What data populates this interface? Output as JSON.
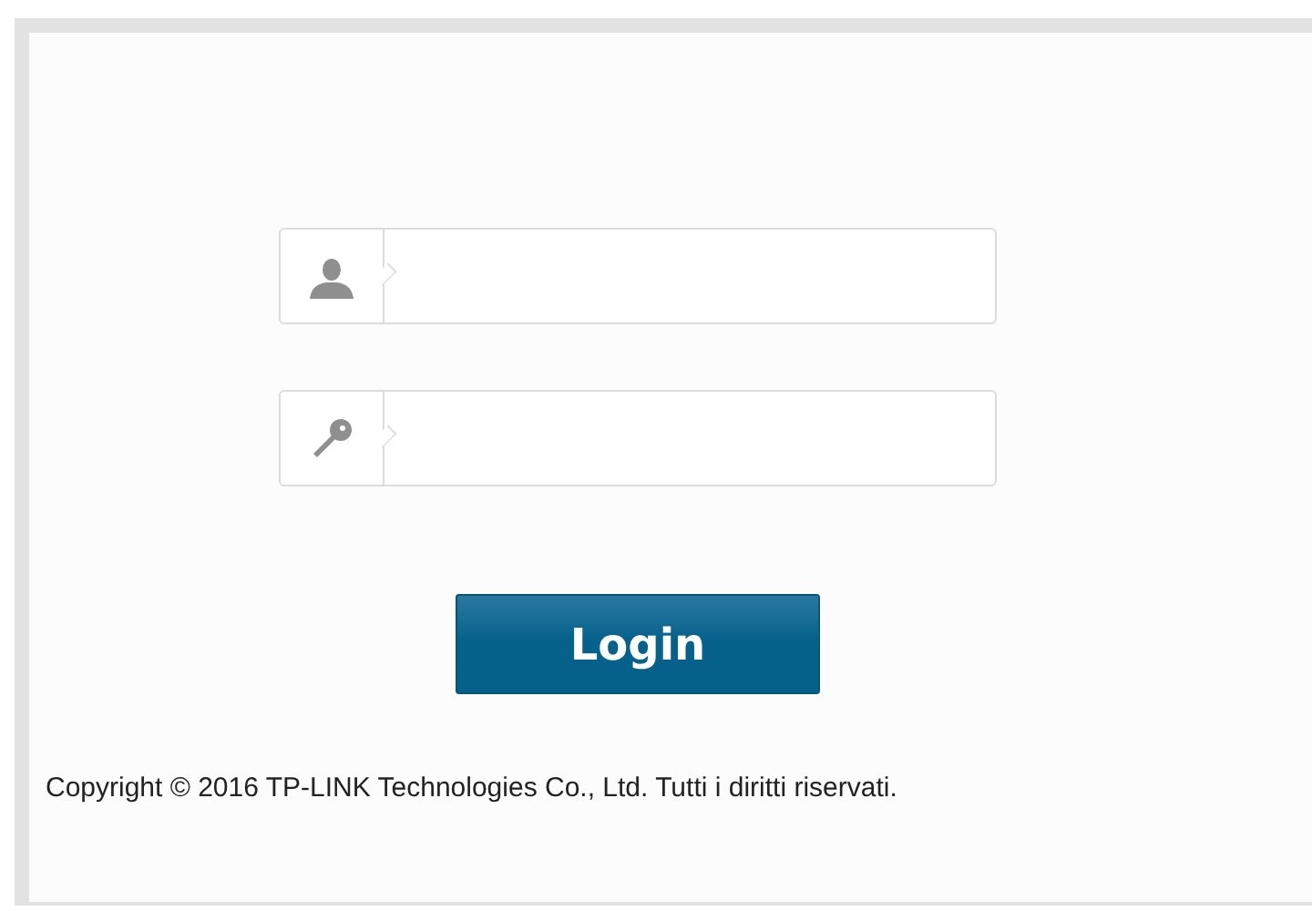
{
  "login_form": {
    "fields": [
      {
        "kind": "username"
      },
      {
        "kind": "password"
      }
    ],
    "button": "Login"
  },
  "footer": {
    "copyright": "Copyright © 2016 TP-LINK Technologies Co., Ltd. Tutti i diritti riservati."
  }
}
